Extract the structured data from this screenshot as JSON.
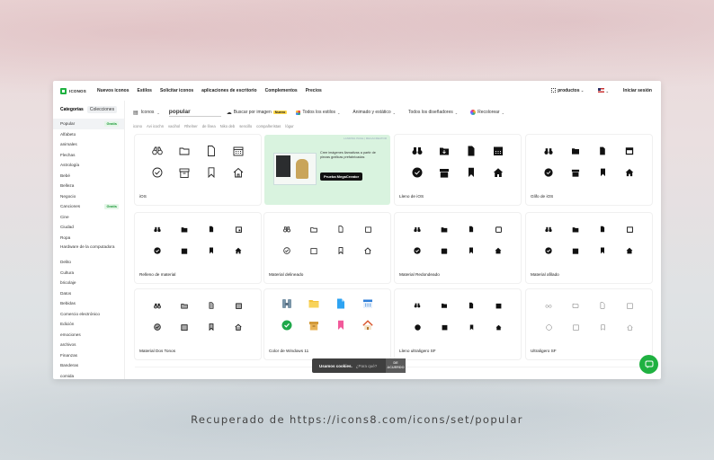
{
  "app": {
    "logo_text": "ICONOS"
  },
  "nav": {
    "links": [
      "Nuevos iconos",
      "Estilos",
      "Solicitar iconos",
      "aplicaciones de escritorio",
      "Complementos",
      "Precios"
    ],
    "products_label": "productos",
    "login_label": "Iniciar sesión"
  },
  "sidebar": {
    "tab_categories": "Categorías",
    "tab_collections": "Colecciones",
    "free_badge": "Gratis",
    "items": [
      "Popular",
      "Alfabeto",
      "animales",
      "Flechas",
      "Astrología",
      "Bebé",
      "Belleza",
      "Negocio",
      "Canciones",
      "Cine",
      "Ciudad",
      "Ropa",
      "Hardware de la computadora",
      "Delito",
      "Cultura",
      "bricolaje",
      "Datos",
      "Bebidas",
      "Comercio electrónico",
      "Edición",
      "emociones",
      "archivos",
      "Finanzas",
      "Banderas",
      "comida"
    ]
  },
  "search": {
    "type_label": "Iconos",
    "query": "popular",
    "image_search_label": "Buscar por imagen",
    "new_badge": "Nuevo",
    "style_filter": "Todos los estilos",
    "animated_filter": "Animado y estático",
    "designer_filter": "Todos los diseñadores",
    "recolor_label": "Recolorear"
  },
  "tags": [
    "icono",
    "Avi icochn",
    "vacihol",
    "Rhelner",
    "de línea",
    "Niko deb",
    "sencillo",
    "compañeristas",
    "lógur"
  ],
  "promo": {
    "tiny": "LANDING PAGE | MEGACREATOR",
    "text": "Cree imágenes llamativas a partir de piezas gráficas prefabricadas",
    "button": "Prueba MegaCreator"
  },
  "cards": [
    {
      "label": "iOS"
    },
    {
      "label": "Lleno de iOS"
    },
    {
      "label": "Glifo de iOS"
    },
    {
      "label": "Relleno de material"
    },
    {
      "label": "Material delineado"
    },
    {
      "label": "Material Redondeado"
    },
    {
      "label": "Material afilado"
    },
    {
      "label": "Material Dos Tonos"
    },
    {
      "label": "Color de Windows 11"
    },
    {
      "label": "Lleno ultraligero SF"
    },
    {
      "label": "Ultraligero SF"
    }
  ],
  "cookie": {
    "text": "Usamos cookies.",
    "link": "¿Para qué?",
    "ok": "DE ACUERDO"
  },
  "caption": "Recuperado de https://icons8.com/icons/set/popular",
  "colors": {
    "brand": "#1fb141",
    "promo_bg": "#d9f3df"
  }
}
